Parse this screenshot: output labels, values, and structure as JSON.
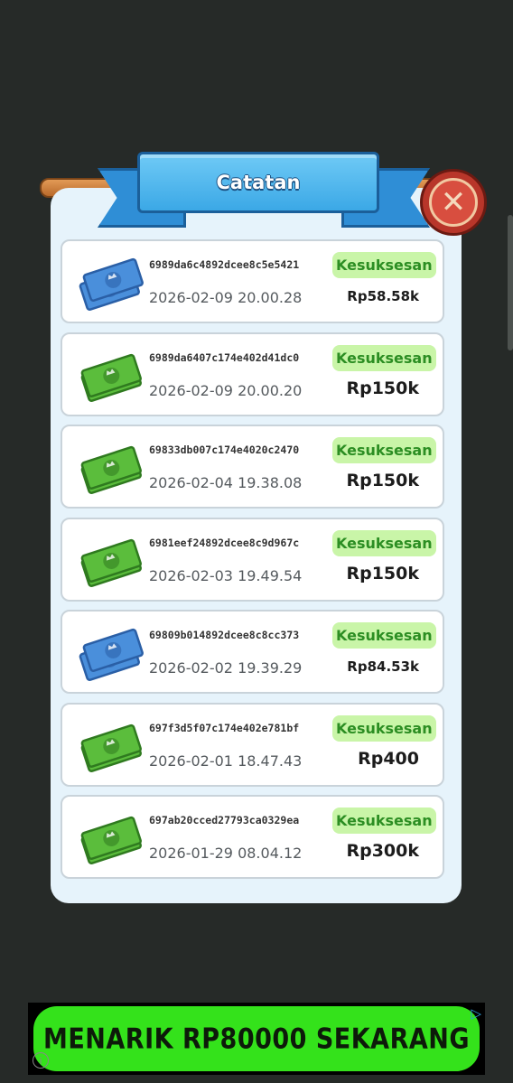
{
  "modal": {
    "title": "Catatan",
    "close_icon": "close-x-icon"
  },
  "records": [
    {
      "id": "6989da6c4892dcee8c5e5421",
      "date": "2026-02-09 20.00.28",
      "status": "Kesuksesan",
      "amount": "Rp58.58k",
      "icon": "blue-cash-stack",
      "color": "#4a8fdb"
    },
    {
      "id": "6989da6407c174e402d41dc0",
      "date": "2026-02-09 20.00.20",
      "status": "Kesuksesan",
      "amount": "Rp150k",
      "icon": "green-cash",
      "color": "#5bbd3c"
    },
    {
      "id": "69833db007c174e4020c2470",
      "date": "2026-02-04 19.38.08",
      "status": "Kesuksesan",
      "amount": "Rp150k",
      "icon": "green-cash",
      "color": "#5bbd3c"
    },
    {
      "id": "6981eef24892dcee8c9d967c",
      "date": "2026-02-03 19.49.54",
      "status": "Kesuksesan",
      "amount": "Rp150k",
      "icon": "green-cash",
      "color": "#5bbd3c"
    },
    {
      "id": "69809b014892dcee8c8cc373",
      "date": "2026-02-02 19.39.29",
      "status": "Kesuksesan",
      "amount": "Rp84.53k",
      "icon": "blue-cash-stack",
      "color": "#4a8fdb"
    },
    {
      "id": "697f3d5f07c174e402e781bf",
      "date": "2026-02-01 18.47.43",
      "status": "Kesuksesan",
      "amount": "Rp400",
      "icon": "green-cash",
      "color": "#5bbd3c"
    },
    {
      "id": "697ab20cced27793ca0329ea",
      "date": "2026-01-29 08.04.12",
      "status": "Kesuksesan",
      "amount": "Rp300k",
      "icon": "green-cash",
      "color": "#5bbd3c"
    }
  ],
  "ad": {
    "label": "MENARIK RP80000 SEKARANG",
    "adchoices_icon": "ad-choices-icon",
    "info_icon": "info-icon"
  },
  "colors": {
    "status_bg": "#c9f5a8",
    "status_text": "#2c8e23",
    "panel_bg": "#e6f3fb",
    "ad_green": "#34e21b"
  }
}
